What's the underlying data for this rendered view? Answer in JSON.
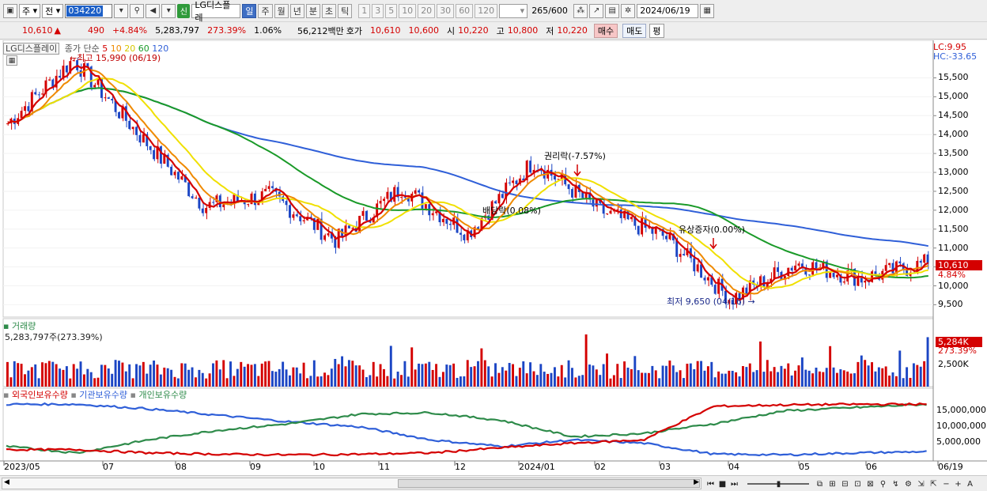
{
  "toolbar": {
    "period_select": "주",
    "mode_select": "전",
    "stock_code": "034220",
    "stock_name": "LG디스플레",
    "new_badge": "신",
    "periods": [
      "일",
      "주",
      "월",
      "년",
      "분",
      "초",
      "틱"
    ],
    "active_period": "일",
    "intervals": [
      "1",
      "3",
      "5",
      "10",
      "20",
      "30",
      "60",
      "120"
    ],
    "count": "265",
    "count_total": "/600",
    "date": "2024/06/19"
  },
  "quote": {
    "price": "10,610",
    "change_arrow": "▲",
    "change": "490",
    "change_pct": "+4.84%",
    "volume": "5,283,797",
    "volume_pct": "273.39%",
    "turnover_pct": "1.06%",
    "amount": "56,212백만",
    "hoga_label": "호가",
    "ask": "10,610",
    "bid": "10,600",
    "open_label": "시",
    "open": "10,220",
    "high_label": "고",
    "high": "10,800",
    "low_label": "저",
    "low": "10,220",
    "buy_label": "매수",
    "sell_label": "매도",
    "avg_label": "평"
  },
  "legend": {
    "name": "LG디스플레이",
    "ma_label": "종가 단순",
    "ma_periods": [
      "5",
      "10",
      "20",
      "60",
      "120"
    ],
    "ma_colors": [
      "#d40000",
      "#ef8a00",
      "#f0e000",
      "#1a9a28",
      "#2f5fd8"
    ],
    "lc": "LC:9.95",
    "hc": "HC:-33.65"
  },
  "annotations": {
    "high": "최고 15,990 (06/19)",
    "low": "최저 9,650 (04/16)",
    "ex_rights": "권리락(-7.57%)",
    "ex_dividend": "배당락(0.08%)",
    "paid_in": "유상증자(0.00%)"
  },
  "price_axis": [
    "15,500",
    "15,000",
    "14,500",
    "14,000",
    "13,500",
    "13,000",
    "12,500",
    "12,000",
    "11,500",
    "11,000",
    "10,500",
    "10,000",
    "9,500"
  ],
  "price_tag": "10,610",
  "price_pct_tag": "4.84%",
  "volume_panel": {
    "title": "거래량",
    "value": "5,283,797주(273.39%)",
    "tag": "5,284K",
    "tag_pct": "273.39%",
    "axis": [
      "2,500K"
    ]
  },
  "holding_panel": {
    "foreign_label": "외국인보유수량",
    "inst_label": "기관보유수량",
    "indiv_label": "개인보유수량",
    "colors": {
      "foreign": "#d40000",
      "inst": "#2f5fd8",
      "indiv": "#2e8b4a"
    },
    "axis": [
      "15,000,000",
      "10,000,000",
      "5,000,000"
    ]
  },
  "date_axis": [
    "2023/05",
    "07",
    "08",
    "09",
    "10",
    "11",
    "12",
    "2024/01",
    "02",
    "03",
    "04",
    "05",
    "06",
    "06/19"
  ],
  "chart_data": {
    "type": "candlestick",
    "series": [
      {
        "name": "LG디스플레이",
        "points": [
          [
            "2023/05",
            14300
          ],
          [
            "06",
            15990
          ],
          [
            "07",
            14000
          ],
          [
            "08",
            12100
          ],
          [
            "09",
            12400
          ],
          [
            "10",
            11200
          ],
          [
            "11",
            12600
          ],
          [
            "12",
            11400
          ],
          [
            "2024/01",
            13300
          ],
          [
            "02",
            12000
          ],
          [
            "03",
            11300
          ],
          [
            "04",
            9650
          ],
          [
            "05",
            10600
          ],
          [
            "06",
            10200
          ],
          [
            "06/19",
            10610
          ]
        ]
      }
    ],
    "ylim": [
      9300,
      16200
    ]
  }
}
